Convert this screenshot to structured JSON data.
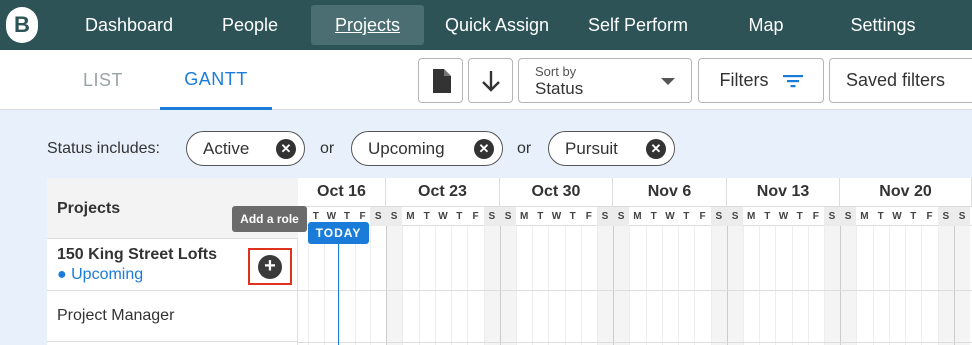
{
  "nav": {
    "logo": "B",
    "items": [
      "Dashboard",
      "People",
      "Projects",
      "Quick Assign",
      "Self Perform",
      "Map",
      "Settings"
    ],
    "active": "Projects"
  },
  "toolbar": {
    "tabs": [
      "LIST",
      "GANTT"
    ],
    "active_tab": "GANTT",
    "sort_label": "Sort by",
    "sort_value": "Status",
    "filters_label": "Filters",
    "saved_filters_label": "Saved filters"
  },
  "status_filter": {
    "label": "Status includes:",
    "chips": [
      "Active",
      "Upcoming",
      "Pursuit"
    ],
    "joiner": "or"
  },
  "gantt": {
    "projects_header": "Projects",
    "tooltip": "Add a role",
    "today_label": "TODAY",
    "weeks": [
      "Oct 16",
      "Oct 23",
      "Oct 30",
      "Nov 6",
      "Nov 13",
      "Nov 20"
    ],
    "day_letters": [
      "S",
      "M",
      "T",
      "W",
      "T",
      "F",
      "S"
    ],
    "rows": [
      {
        "name": "150 King Street Lofts",
        "status": "● Upcoming"
      },
      {
        "name": "Project Manager"
      }
    ]
  },
  "colors": {
    "nav_bg": "#2d5356",
    "accent": "#1a7cd8",
    "highlight_border": "#e0301e"
  }
}
